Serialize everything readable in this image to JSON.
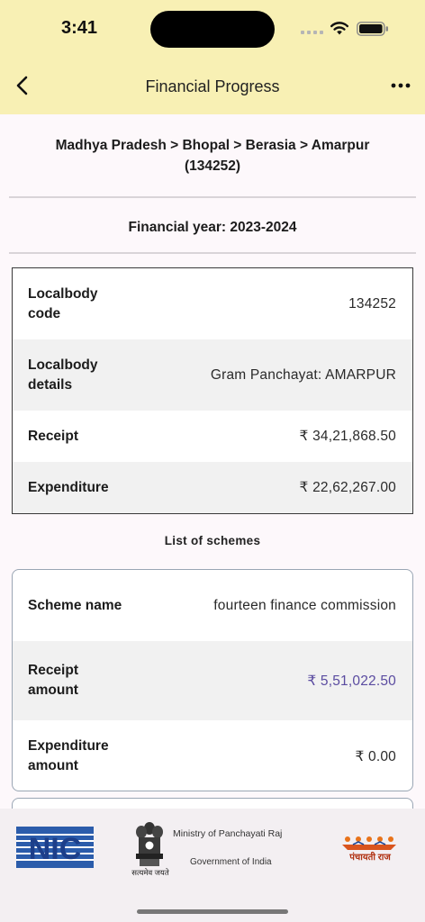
{
  "status": {
    "time": "3:41"
  },
  "header": {
    "title": "Financial Progress"
  },
  "breadcrumb": {
    "line1": "Madhya Pradesh > Bhopal > Berasia > Amarpur",
    "line2": "(134252)"
  },
  "financial_year": "Financial year: 2023-2024",
  "summary": {
    "rows": [
      {
        "label": "Localbody code",
        "value": "134252"
      },
      {
        "label": "Localbody details",
        "value": "Gram Panchayat: AMARPUR"
      },
      {
        "label": "Receipt",
        "value": "₹ 34,21,868.50"
      },
      {
        "label": "Expenditure",
        "value": "₹ 22,62,267.00"
      }
    ]
  },
  "schemes": {
    "heading": "List of schemes",
    "items": [
      {
        "rows": [
          {
            "label": "Scheme name",
            "value": "fourteen finance commission"
          },
          {
            "label": "Receipt amount",
            "value": "₹ 5,51,022.50"
          },
          {
            "label": "Expenditure amount",
            "value": "₹ 0.00"
          }
        ]
      }
    ]
  },
  "footer": {
    "ministry": "Ministry of Panchayati Raj",
    "government": "Government of India",
    "emblem_caption": "सत्यमेव जयते",
    "pr_caption": "पंचायती राज",
    "nic_label": "NIC"
  },
  "colors": {
    "appbar": "#f8f0b4",
    "link_value": "#5a4ba0"
  }
}
